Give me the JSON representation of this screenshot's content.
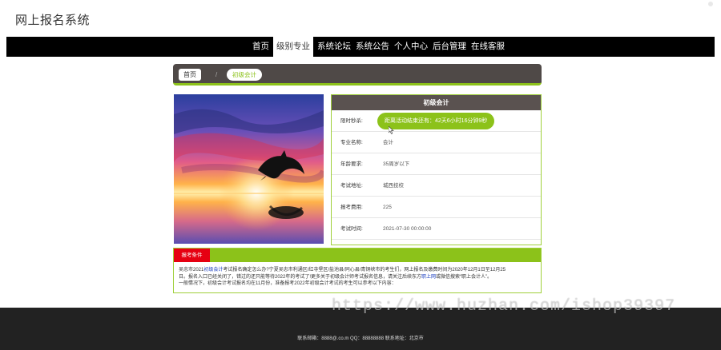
{
  "site": {
    "title": "网上报名系统"
  },
  "nav": {
    "items": [
      {
        "label": "首页"
      },
      {
        "label": "级别专业"
      },
      {
        "label": "系统论坛"
      },
      {
        "label": "系统公告"
      },
      {
        "label": "个人中心"
      },
      {
        "label": "后台管理"
      },
      {
        "label": "在线客服"
      }
    ],
    "active_index": 1
  },
  "breadcrumb": {
    "home": "首页",
    "separator": "/",
    "current": "初级会计"
  },
  "info": {
    "title": "初级会计",
    "countdown_label": "限时秒杀:",
    "countdown_text": "距离活动结束还有：42天6小时16分钟9秒",
    "rows": [
      {
        "label": "专业名称:",
        "value": "会计"
      },
      {
        "label": "年龄要求:",
        "value": "35周岁以下"
      },
      {
        "label": "考试地址:",
        "value": "城西技校"
      },
      {
        "label": "报考费用:",
        "value": "225"
      },
      {
        "label": "考试时间:",
        "value": "2021-07-30 00:00:00"
      }
    ]
  },
  "conditions": {
    "tab": "报考条件",
    "line1_pre": "吴忠市2021",
    "line1_link": "初级会计",
    "line1_post": "考试报名确定怎么办?宁夏吴忠市利通区/红寺堡区/盐池县/同心县/青铜峡市的考生们，网上报名及缴费时间为2020年12月1日至12月25",
    "line2_pre": "日。报名入口已经关闭了，错过的还只能等待2022年的考试了!更多关于初级会计师考试报名信息，请关注后续东方",
    "line2_link": "职上网",
    "line2_post": "或微信搜索“职上会计人”。",
    "line3": "一般情况下，初级会计考试报名均在11月份，准备报考2022年初级会计考试的考生可以参考以下内容："
  },
  "footer": {
    "text": "联系邮箱：8888@.co.m QQ：88888888 联系地址：北京市"
  },
  "watermark": "https://www.huzhan.com/ishop39397",
  "colors": {
    "accent": "#8cc21a",
    "nav_bg": "#000000",
    "header_bar": "#4f4947",
    "tab_red": "#e60012",
    "footer_bg": "#222222"
  }
}
